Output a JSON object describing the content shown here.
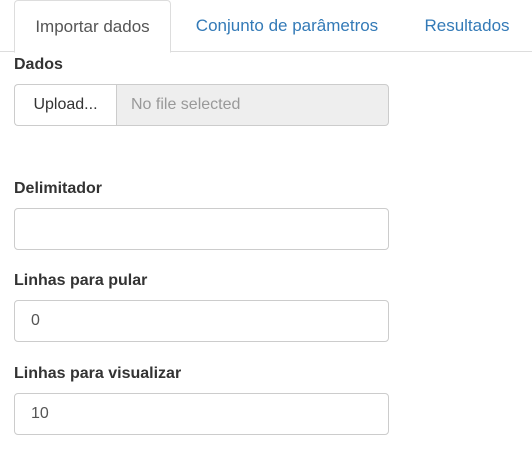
{
  "tabs": [
    {
      "label": "Importar dados",
      "active": true
    },
    {
      "label": "Conjunto de parâmetros",
      "active": false
    },
    {
      "label": "Resultados",
      "active": false
    }
  ],
  "dados": {
    "label": "Dados",
    "upload_button": "Upload...",
    "file_display": "No file selected"
  },
  "delimitador": {
    "label": "Delimitador",
    "value": ""
  },
  "linhas_pular": {
    "label": "Linhas para pular",
    "value": "0"
  },
  "linhas_visualizar": {
    "label": "Linhas para visualizar",
    "value": "10"
  },
  "colors": {
    "link": "#337ab7",
    "label_text": "#333333",
    "border": "#cccccc",
    "disabled_bg": "#eeeeee",
    "placeholder": "#999999"
  }
}
